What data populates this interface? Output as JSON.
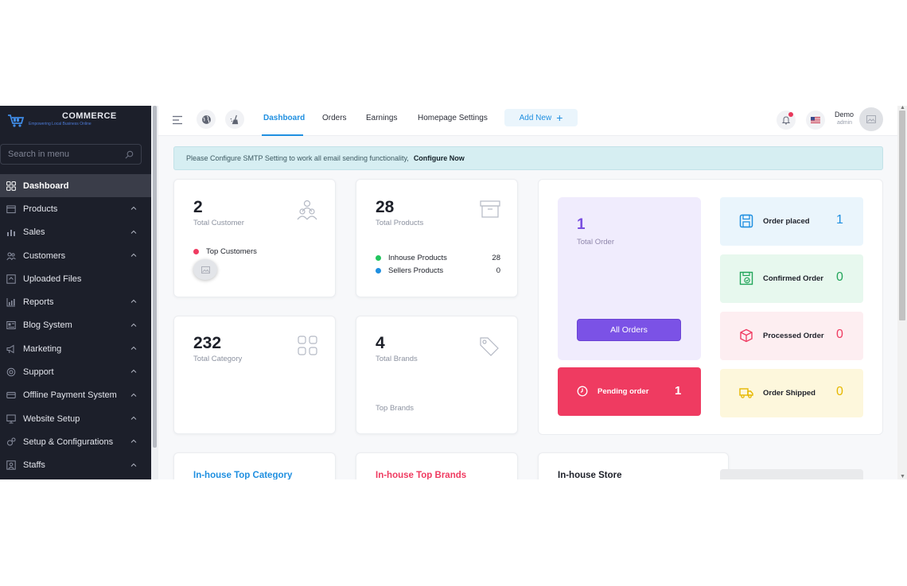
{
  "sidebar": {
    "logo": {
      "brand": "COMMERCE",
      "tagline": "Empowering Local Business Online"
    },
    "search_placeholder": "Search in menu",
    "items": [
      {
        "label": "Dashboard",
        "icon": "dashboard-grid-icon"
      },
      {
        "label": "Products",
        "icon": "box-icon"
      },
      {
        "label": "Sales",
        "icon": "bar-chart-icon"
      },
      {
        "label": "Customers",
        "icon": "users-icon"
      },
      {
        "label": "Uploaded Files",
        "icon": "upload-icon"
      },
      {
        "label": "Reports",
        "icon": "report-chart-icon"
      },
      {
        "label": "Blog System",
        "icon": "blog-icon"
      },
      {
        "label": "Marketing",
        "icon": "megaphone-icon"
      },
      {
        "label": "Support",
        "icon": "support-icon"
      },
      {
        "label": "Offline Payment System",
        "icon": "payment-icon"
      },
      {
        "label": "Website Setup",
        "icon": "monitor-icon"
      },
      {
        "label": "Setup & Configurations",
        "icon": "gears-icon"
      },
      {
        "label": "Staffs",
        "icon": "staff-icon"
      }
    ]
  },
  "topbar": {
    "nav": [
      "Dashboard",
      "Orders",
      "Earnings",
      "Homepage Settings"
    ],
    "add_new": "Add New",
    "user_name": "Demo",
    "user_role": "admin"
  },
  "alert": {
    "message": "Please Configure SMTP Setting to work all email sending functionality,",
    "action": "Configure Now"
  },
  "cards": {
    "customers": {
      "value": "2",
      "label": "Total Customer",
      "top_label": "Top Customers"
    },
    "products": {
      "value": "28",
      "label": "Total Products",
      "rows": [
        {
          "label": "Inhouse Products",
          "value": "28",
          "color": "#22c55e"
        },
        {
          "label": "Sellers Products",
          "value": "0",
          "color": "#1f8fe0"
        }
      ]
    },
    "category": {
      "value": "232",
      "label": "Total Category"
    },
    "brands": {
      "value": "4",
      "label": "Total Brands",
      "top_label": "Top Brands"
    }
  },
  "orders": {
    "total": {
      "value": "1",
      "label": "Total Order",
      "button": "All Orders"
    },
    "pending": {
      "label": "Pending order",
      "value": "1"
    },
    "stats": [
      {
        "label": "Order placed",
        "value": "1",
        "bg": "#eaf5fc",
        "color": "#1f8fe0",
        "icon": "save-icon"
      },
      {
        "label": "Confirmed Order",
        "value": "0",
        "bg": "#e7f8ee",
        "color": "#22a55a",
        "icon": "confirm-box-icon"
      },
      {
        "label": "Processed Order",
        "value": "0",
        "bg": "#fdeef1",
        "color": "#ef3b61",
        "icon": "cube-icon"
      },
      {
        "label": "Order Shipped",
        "value": "0",
        "bg": "#fdf7dc",
        "color": "#e6b800",
        "icon": "truck-icon"
      }
    ]
  },
  "sections": {
    "top_category": "In-house Top Category",
    "top_brands": "In-house Top Brands",
    "store": "In-house Store"
  },
  "colors": {
    "accent": "#1f8fe0",
    "purple": "#7b52e6",
    "pink": "#ef3b61",
    "sidebar": "#1c1f2a"
  }
}
